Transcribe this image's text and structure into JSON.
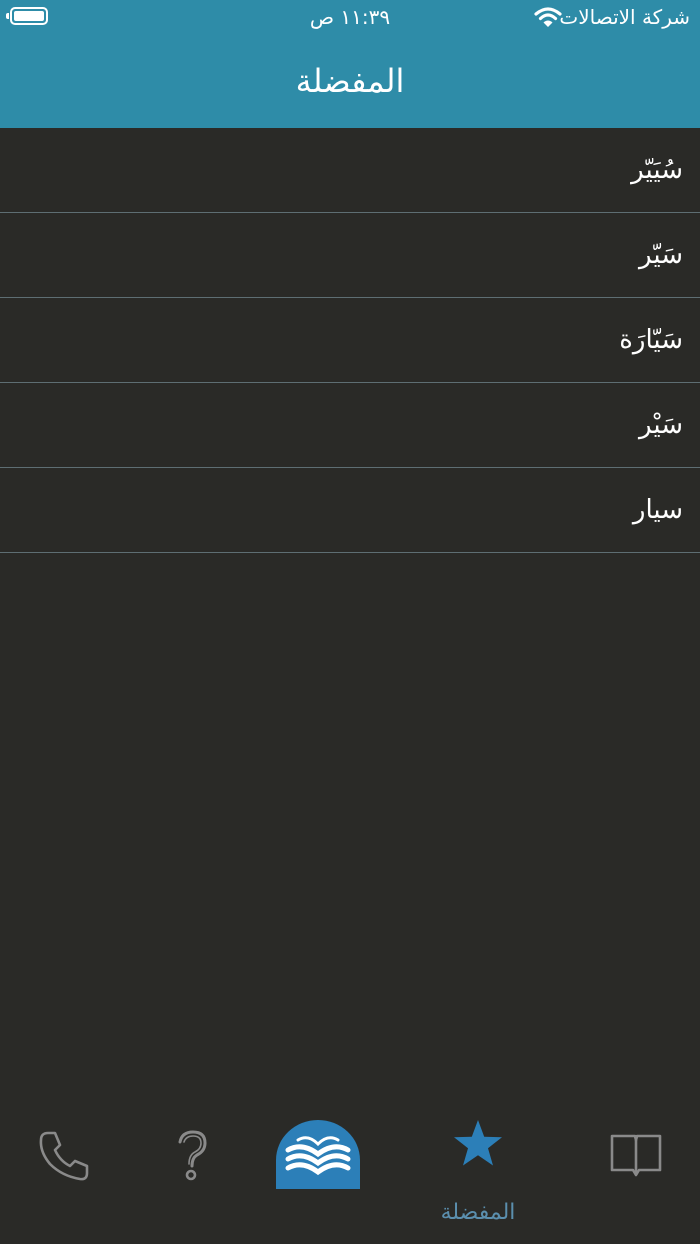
{
  "status_bar": {
    "carrier": "شركة الاتصالات",
    "time": "١١:٣٩ ص"
  },
  "header": {
    "title": "المفضلة"
  },
  "favorites": {
    "items": [
      "سُيَيّر",
      "سَيّر",
      "سَيّارَة",
      "سَيْر",
      "سيار"
    ]
  },
  "tab_bar": {
    "active_tab_label": "المفضلة",
    "tabs": [
      "book-icon",
      "star-icon",
      "home-logo-icon",
      "help-icon",
      "phone-icon"
    ]
  },
  "colors": {
    "header": "#2e8ca8",
    "background": "#2a2a27",
    "accent": "#2c7fb8",
    "divider": "#5e6e73",
    "inactive_icon": "#8a8a8a"
  }
}
